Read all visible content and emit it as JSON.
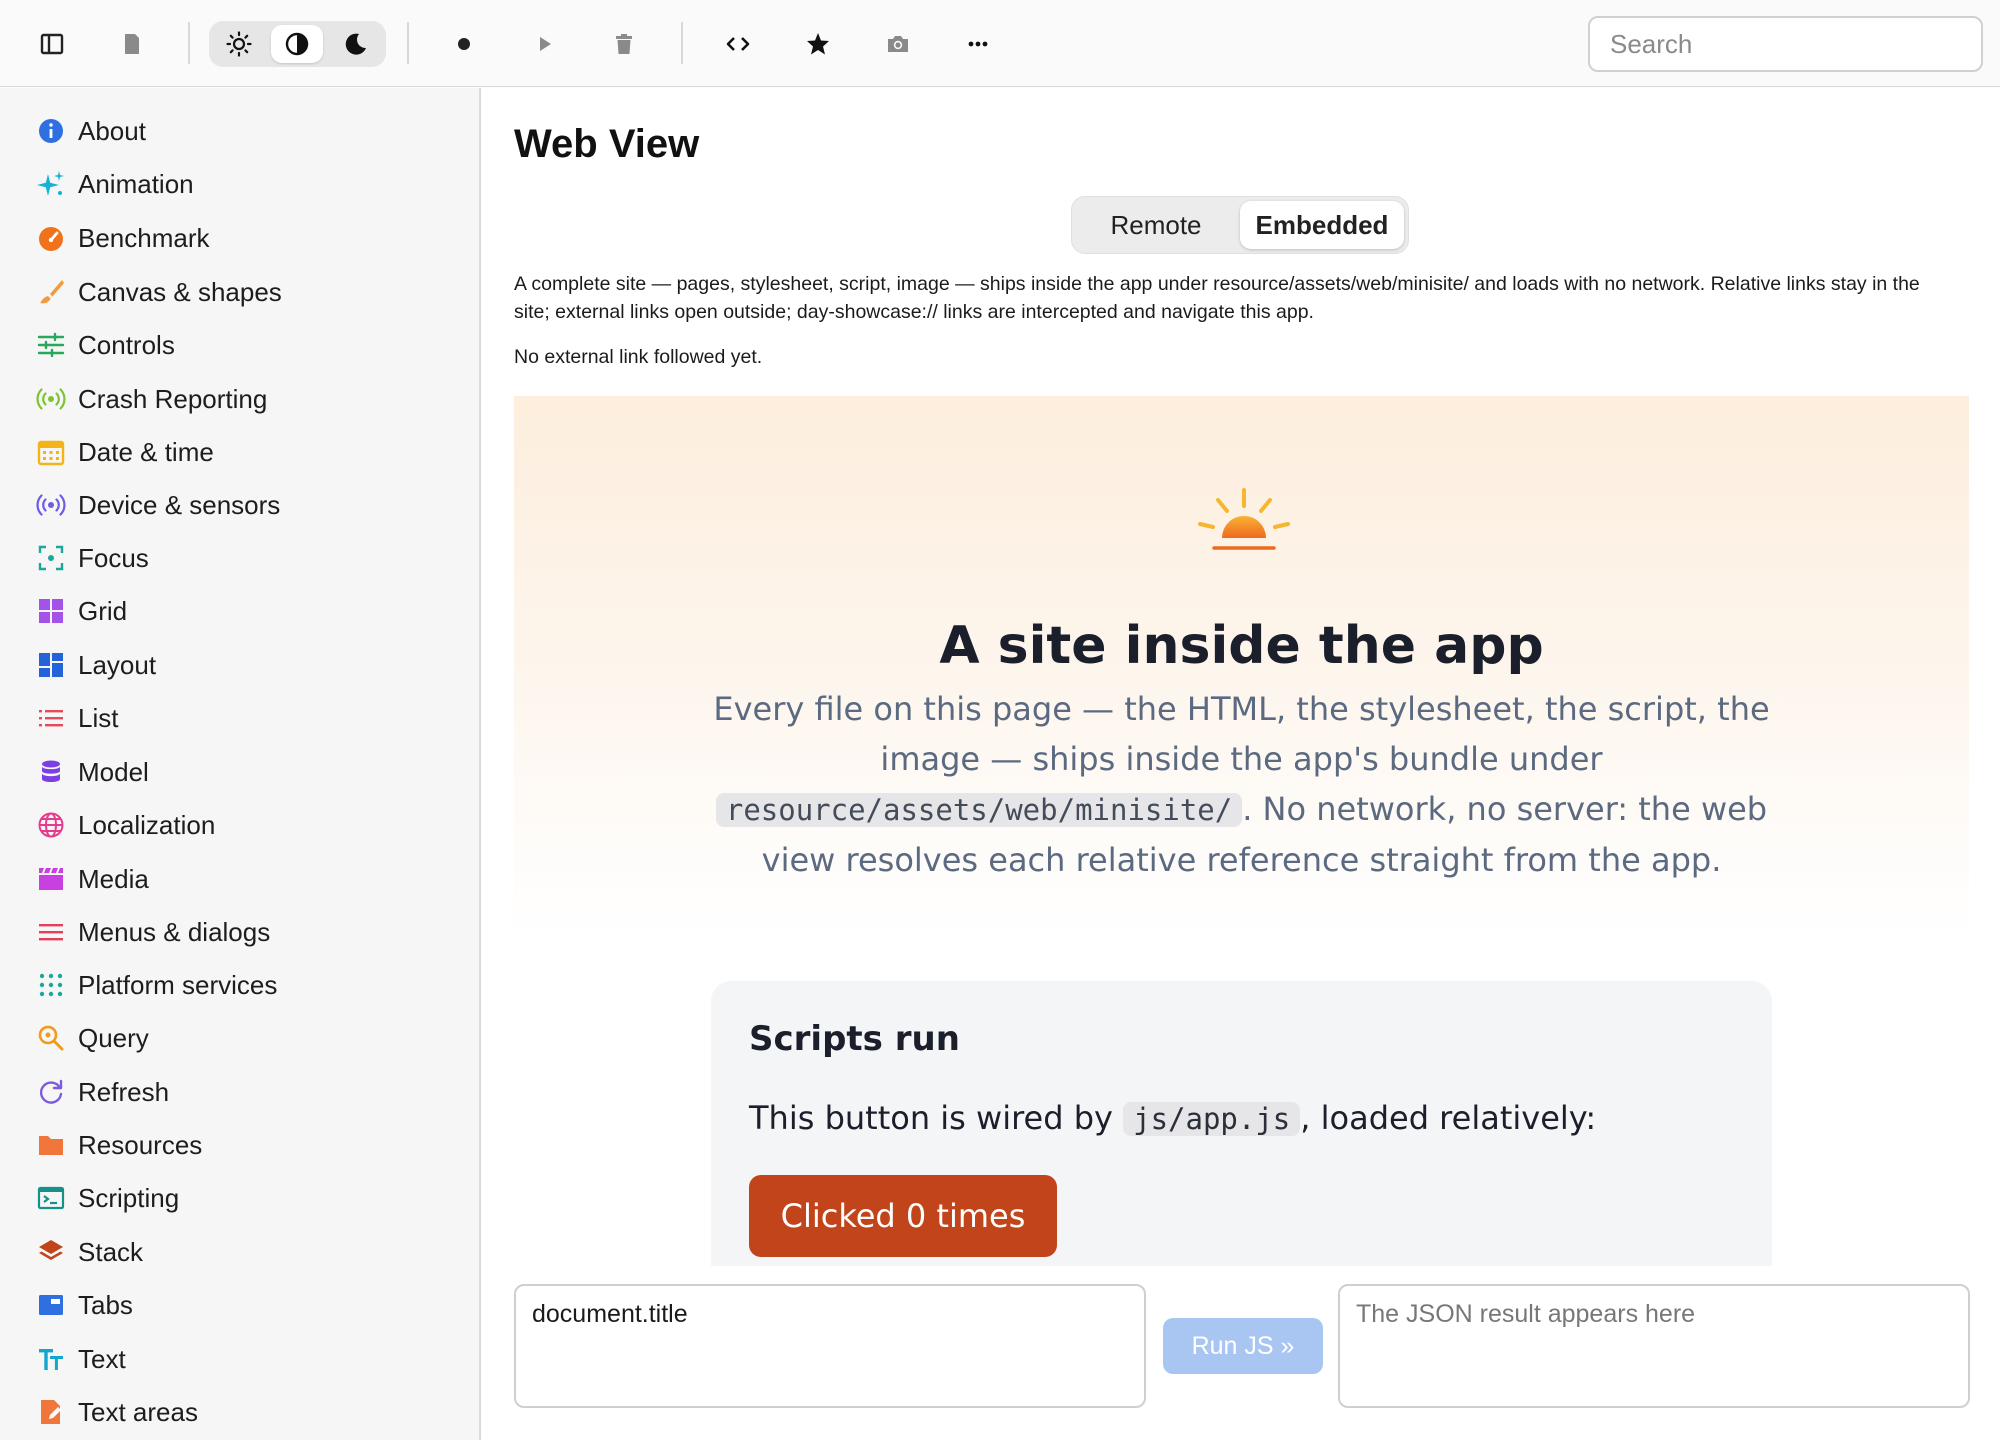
{
  "toolbar": {
    "search_placeholder": "Search"
  },
  "sidebar": {
    "items": [
      {
        "label": "About",
        "icon": "info-icon",
        "color": "#2f6fe0"
      },
      {
        "label": "Animation",
        "icon": "sparkles-icon",
        "color": "#13b2d6"
      },
      {
        "label": "Benchmark",
        "icon": "speedometer-icon",
        "color": "#f0721b"
      },
      {
        "label": "Canvas & shapes",
        "icon": "paintbrush-icon",
        "color": "#f29a3c"
      },
      {
        "label": "Controls",
        "icon": "sliders-icon",
        "color": "#27a85a"
      },
      {
        "label": "Crash Reporting",
        "icon": "broadcast-icon",
        "color": "#7cc431"
      },
      {
        "label": "Date & time",
        "icon": "calendar-icon",
        "color": "#f2b418"
      },
      {
        "label": "Device & sensors",
        "icon": "sensor-icon",
        "color": "#6b5be6"
      },
      {
        "label": "Focus",
        "icon": "focus-icon",
        "color": "#1aa89a"
      },
      {
        "label": "Grid",
        "icon": "grid-icon",
        "color": "#a452e8"
      },
      {
        "label": "Layout",
        "icon": "layout-icon",
        "color": "#2563d8"
      },
      {
        "label": "List",
        "icon": "list-icon",
        "color": "#e34a5b"
      },
      {
        "label": "Model",
        "icon": "database-icon",
        "color": "#7b3fe4"
      },
      {
        "label": "Localization",
        "icon": "globe-icon",
        "color": "#e83a8d"
      },
      {
        "label": "Media",
        "icon": "clapperboard-icon",
        "color": "#c940e0"
      },
      {
        "label": "Menus & dialogs",
        "icon": "menu-icon",
        "color": "#e3405c"
      },
      {
        "label": "Platform services",
        "icon": "dots-grid-icon",
        "color": "#1aa89a"
      },
      {
        "label": "Query",
        "icon": "magnifier-icon",
        "color": "#f29a1b"
      },
      {
        "label": "Refresh",
        "icon": "refresh-icon",
        "color": "#7e5ae0"
      },
      {
        "label": "Resources",
        "icon": "folder-icon",
        "color": "#f0763c"
      },
      {
        "label": "Scripting",
        "icon": "terminal-icon",
        "color": "#15908a"
      },
      {
        "label": "Stack",
        "icon": "stack-icon",
        "color": "#c2441b"
      },
      {
        "label": "Tabs",
        "icon": "tabs-icon",
        "color": "#2f6fe0"
      },
      {
        "label": "Text",
        "icon": "text-size-icon",
        "color": "#13a6cf"
      },
      {
        "label": "Text areas",
        "icon": "document-edit-icon",
        "color": "#f0763c"
      }
    ]
  },
  "page": {
    "title": "Web View",
    "segments": [
      "Remote",
      "Embedded"
    ],
    "selected_segment": "Embedded",
    "description": "A complete site — pages, stylesheet, script, image — ships inside the app under resource/assets/web/minisite/ and loads with no network. Relative links stay in the site; external links open outside; day-showcase:// links are intercepted and navigate this app.",
    "status": "No external link followed yet."
  },
  "webview": {
    "hero_title": "A site inside the app",
    "hero_text_1": "Every file on this page — the HTML, the stylesheet, the script, the image — ships inside the app's bundle under ",
    "hero_code": "resource/assets/web/minisite/",
    "hero_text_2": ". No network, no server: the web view resolves each relative reference straight from the app.",
    "card_title": "Scripts run",
    "card_text_1": "This button is wired by ",
    "card_code": "js/app.js",
    "card_text_2": ", loaded relatively:",
    "button_label": "Clicked 0 times",
    "button_color": "#c2441b"
  },
  "js_console": {
    "input_value": "document.title",
    "run_label": "Run JS »",
    "output_placeholder": "The JSON result appears here"
  }
}
